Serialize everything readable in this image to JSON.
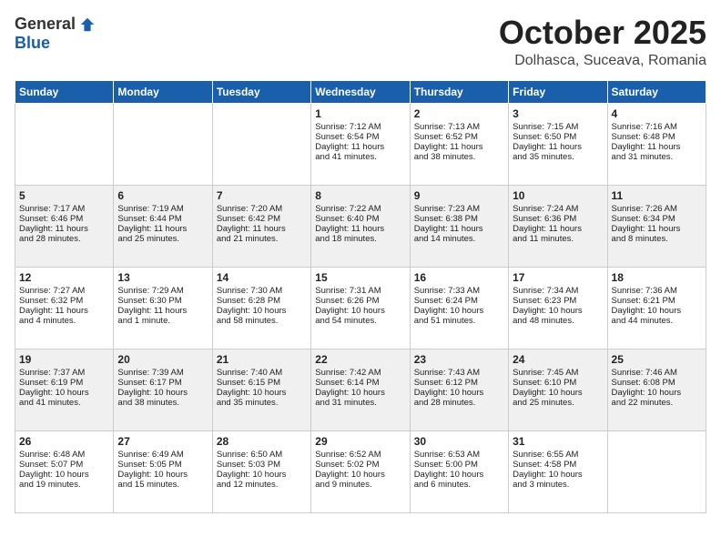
{
  "header": {
    "logo_general": "General",
    "logo_blue": "Blue",
    "month": "October 2025",
    "location": "Dolhasca, Suceava, Romania"
  },
  "days_of_week": [
    "Sunday",
    "Monday",
    "Tuesday",
    "Wednesday",
    "Thursday",
    "Friday",
    "Saturday"
  ],
  "weeks": [
    {
      "shaded": false,
      "days": [
        {
          "num": "",
          "text": ""
        },
        {
          "num": "",
          "text": ""
        },
        {
          "num": "",
          "text": ""
        },
        {
          "num": "1",
          "text": "Sunrise: 7:12 AM\nSunset: 6:54 PM\nDaylight: 11 hours\nand 41 minutes."
        },
        {
          "num": "2",
          "text": "Sunrise: 7:13 AM\nSunset: 6:52 PM\nDaylight: 11 hours\nand 38 minutes."
        },
        {
          "num": "3",
          "text": "Sunrise: 7:15 AM\nSunset: 6:50 PM\nDaylight: 11 hours\nand 35 minutes."
        },
        {
          "num": "4",
          "text": "Sunrise: 7:16 AM\nSunset: 6:48 PM\nDaylight: 11 hours\nand 31 minutes."
        }
      ]
    },
    {
      "shaded": true,
      "days": [
        {
          "num": "5",
          "text": "Sunrise: 7:17 AM\nSunset: 6:46 PM\nDaylight: 11 hours\nand 28 minutes."
        },
        {
          "num": "6",
          "text": "Sunrise: 7:19 AM\nSunset: 6:44 PM\nDaylight: 11 hours\nand 25 minutes."
        },
        {
          "num": "7",
          "text": "Sunrise: 7:20 AM\nSunset: 6:42 PM\nDaylight: 11 hours\nand 21 minutes."
        },
        {
          "num": "8",
          "text": "Sunrise: 7:22 AM\nSunset: 6:40 PM\nDaylight: 11 hours\nand 18 minutes."
        },
        {
          "num": "9",
          "text": "Sunrise: 7:23 AM\nSunset: 6:38 PM\nDaylight: 11 hours\nand 14 minutes."
        },
        {
          "num": "10",
          "text": "Sunrise: 7:24 AM\nSunset: 6:36 PM\nDaylight: 11 hours\nand 11 minutes."
        },
        {
          "num": "11",
          "text": "Sunrise: 7:26 AM\nSunset: 6:34 PM\nDaylight: 11 hours\nand 8 minutes."
        }
      ]
    },
    {
      "shaded": false,
      "days": [
        {
          "num": "12",
          "text": "Sunrise: 7:27 AM\nSunset: 6:32 PM\nDaylight: 11 hours\nand 4 minutes."
        },
        {
          "num": "13",
          "text": "Sunrise: 7:29 AM\nSunset: 6:30 PM\nDaylight: 11 hours\nand 1 minute."
        },
        {
          "num": "14",
          "text": "Sunrise: 7:30 AM\nSunset: 6:28 PM\nDaylight: 10 hours\nand 58 minutes."
        },
        {
          "num": "15",
          "text": "Sunrise: 7:31 AM\nSunset: 6:26 PM\nDaylight: 10 hours\nand 54 minutes."
        },
        {
          "num": "16",
          "text": "Sunrise: 7:33 AM\nSunset: 6:24 PM\nDaylight: 10 hours\nand 51 minutes."
        },
        {
          "num": "17",
          "text": "Sunrise: 7:34 AM\nSunset: 6:23 PM\nDaylight: 10 hours\nand 48 minutes."
        },
        {
          "num": "18",
          "text": "Sunrise: 7:36 AM\nSunset: 6:21 PM\nDaylight: 10 hours\nand 44 minutes."
        }
      ]
    },
    {
      "shaded": true,
      "days": [
        {
          "num": "19",
          "text": "Sunrise: 7:37 AM\nSunset: 6:19 PM\nDaylight: 10 hours\nand 41 minutes."
        },
        {
          "num": "20",
          "text": "Sunrise: 7:39 AM\nSunset: 6:17 PM\nDaylight: 10 hours\nand 38 minutes."
        },
        {
          "num": "21",
          "text": "Sunrise: 7:40 AM\nSunset: 6:15 PM\nDaylight: 10 hours\nand 35 minutes."
        },
        {
          "num": "22",
          "text": "Sunrise: 7:42 AM\nSunset: 6:14 PM\nDaylight: 10 hours\nand 31 minutes."
        },
        {
          "num": "23",
          "text": "Sunrise: 7:43 AM\nSunset: 6:12 PM\nDaylight: 10 hours\nand 28 minutes."
        },
        {
          "num": "24",
          "text": "Sunrise: 7:45 AM\nSunset: 6:10 PM\nDaylight: 10 hours\nand 25 minutes."
        },
        {
          "num": "25",
          "text": "Sunrise: 7:46 AM\nSunset: 6:08 PM\nDaylight: 10 hours\nand 22 minutes."
        }
      ]
    },
    {
      "shaded": false,
      "days": [
        {
          "num": "26",
          "text": "Sunrise: 6:48 AM\nSunset: 5:07 PM\nDaylight: 10 hours\nand 19 minutes."
        },
        {
          "num": "27",
          "text": "Sunrise: 6:49 AM\nSunset: 5:05 PM\nDaylight: 10 hours\nand 15 minutes."
        },
        {
          "num": "28",
          "text": "Sunrise: 6:50 AM\nSunset: 5:03 PM\nDaylight: 10 hours\nand 12 minutes."
        },
        {
          "num": "29",
          "text": "Sunrise: 6:52 AM\nSunset: 5:02 PM\nDaylight: 10 hours\nand 9 minutes."
        },
        {
          "num": "30",
          "text": "Sunrise: 6:53 AM\nSunset: 5:00 PM\nDaylight: 10 hours\nand 6 minutes."
        },
        {
          "num": "31",
          "text": "Sunrise: 6:55 AM\nSunset: 4:58 PM\nDaylight: 10 hours\nand 3 minutes."
        },
        {
          "num": "",
          "text": ""
        }
      ]
    }
  ]
}
